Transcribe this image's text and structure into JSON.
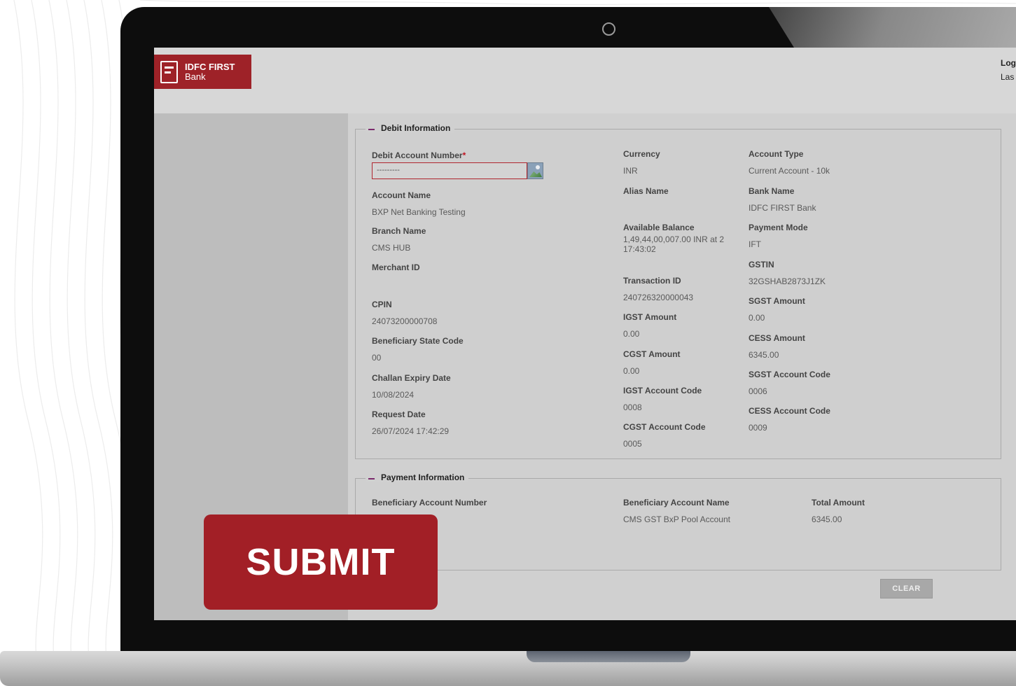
{
  "colors": {
    "brand": "#9e2228",
    "submit": "#a21f26",
    "required": "#c1121f"
  },
  "header": {
    "logo_line1": "IDFC FIRST",
    "logo_line2": "Bank",
    "user_link1": "Log",
    "user_link2": "Las"
  },
  "debit": {
    "legend": "Debit Information",
    "debit_account_label": "Debit Account Number",
    "required_mark": "*",
    "debit_account_value": "---------",
    "account_name_label": "Account Name",
    "account_name_value": "BXP Net Banking Testing",
    "branch_name_label": "Branch Name",
    "branch_name_value": "CMS HUB",
    "merchant_id_label": "Merchant ID",
    "cpin_label": "CPIN",
    "cpin_value": "24073200000708",
    "beneficiary_state_label": "Beneficiary State Code",
    "beneficiary_state_value": "00",
    "challan_expiry_label": "Challan Expiry Date",
    "challan_expiry_value": "10/08/2024",
    "request_date_label": "Request Date",
    "request_date_value": "26/07/2024 17:42:29",
    "currency_label": "Currency",
    "currency_value": "INR",
    "alias_name_label": "Alias Name",
    "available_balance_label": "Available Balance",
    "available_balance_line1": "1,49,44,00,007.00 INR at 2",
    "available_balance_line2": "17:43:02",
    "transaction_id_label": "Transaction ID",
    "transaction_id_value": "240726320000043",
    "igst_amount_label": "IGST Amount",
    "igst_amount_value": "0.00",
    "cgst_amount_label": "CGST Amount",
    "cgst_amount_value": "0.00",
    "igst_code_label": "IGST Account Code",
    "igst_code_value": "0008",
    "cgst_code_label": "CGST Account Code",
    "cgst_code_value": "0005",
    "account_type_label": "Account Type",
    "account_type_value": "Current Account - 10k",
    "bank_name_label": "Bank Name",
    "bank_name_value": "IDFC FIRST Bank",
    "payment_mode_label": "Payment Mode",
    "payment_mode_value": "IFT",
    "gstin_label": "GSTIN",
    "gstin_value": "32GSHAB2873J1ZK",
    "sgst_amount_label": "SGST Amount",
    "sgst_amount_value": "0.00",
    "cess_amount_label": "CESS Amount",
    "cess_amount_value": "6345.00",
    "sgst_code_label": "SGST Account Code",
    "sgst_code_value": "0006",
    "cess_code_label": "CESS Account Code",
    "cess_code_value": "0009"
  },
  "payment": {
    "legend": "Payment Information",
    "beneficiary_account_number_label": "Beneficiary Account Number",
    "beneficiary_account_name_label": "Beneficiary Account Name",
    "beneficiary_account_name_value": "CMS GST BxP Pool Account",
    "total_amount_label": "Total Amount",
    "total_amount_value": "6345.00"
  },
  "actions": {
    "clear_label": "CLEAR",
    "submit_label": "SUBMIT"
  }
}
